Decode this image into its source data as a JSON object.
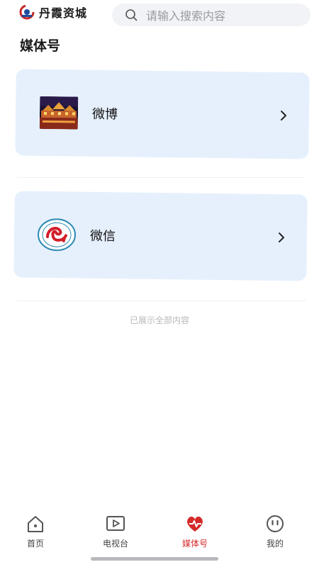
{
  "header": {
    "brand_name": "丹霞资城",
    "search_placeholder": "请输入搜索内容"
  },
  "page": {
    "title": "媒体号"
  },
  "accounts": [
    {
      "label": "微博",
      "icon": "night-town-photo"
    },
    {
      "label": "微信",
      "icon": "wechat-account-emblem"
    }
  ],
  "footer_text": "已展示全部内容",
  "tabbar": {
    "items": [
      {
        "label": "首页",
        "icon": "home-icon"
      },
      {
        "label": "电视台",
        "icon": "tv-play-icon"
      },
      {
        "label": "媒体号",
        "icon": "heart-icon"
      },
      {
        "label": "我的",
        "icon": "face-icon"
      }
    ],
    "active": "媒体号",
    "active_color": "#d42a2a"
  }
}
